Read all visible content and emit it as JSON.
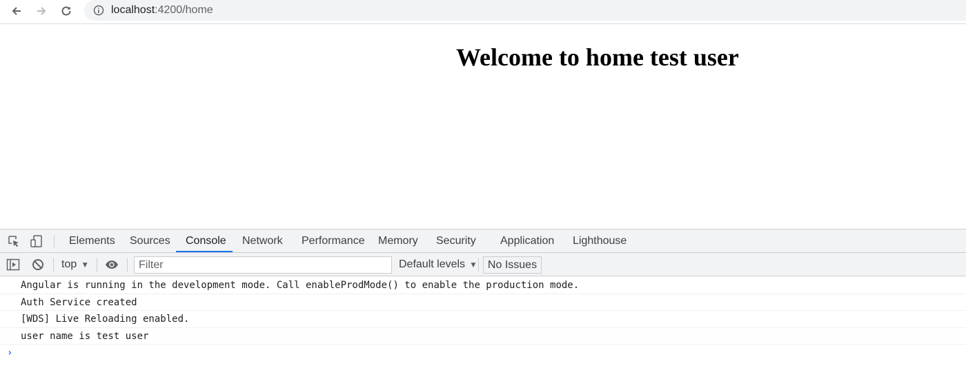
{
  "browser": {
    "url_host": "localhost",
    "url_path": ":4200/home"
  },
  "page": {
    "title": "Welcome to home test user"
  },
  "devtools": {
    "tabs": [
      {
        "label": "Elements"
      },
      {
        "label": "Sources"
      },
      {
        "label": "Console"
      },
      {
        "label": "Network"
      },
      {
        "label": "Performance"
      },
      {
        "label": "Memory"
      },
      {
        "label": "Security"
      },
      {
        "label": "Application"
      },
      {
        "label": "Lighthouse"
      }
    ],
    "active_tab": "Console",
    "toolbar": {
      "context": "top",
      "filter_placeholder": "Filter",
      "levels": "Default levels",
      "issues": "No Issues"
    },
    "console_messages": [
      "Angular is running in the development mode. Call enableProdMode() to enable the production mode.",
      "Auth Service created",
      "[WDS] Live Reloading enabled.",
      "user name is test user"
    ],
    "accent_color": "#1a73e8"
  }
}
